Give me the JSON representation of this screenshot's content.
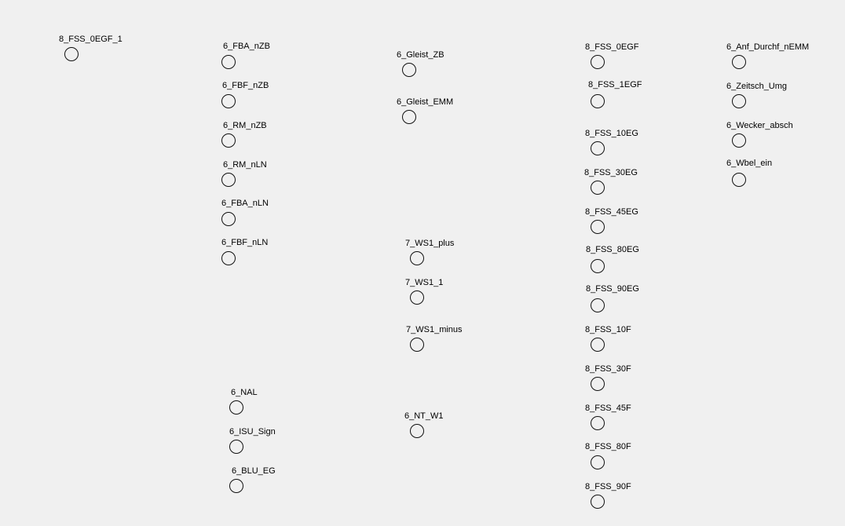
{
  "signals": [
    {
      "id": "s01",
      "label": "8_FSS_0EGF_1"
    },
    {
      "id": "s02",
      "label": "6_FBA_nZB"
    },
    {
      "id": "s03",
      "label": "6_FBF_nZB"
    },
    {
      "id": "s04",
      "label": "6_RM_nZB"
    },
    {
      "id": "s05",
      "label": "6_RM_nLN"
    },
    {
      "id": "s06",
      "label": "6_FBA_nLN"
    },
    {
      "id": "s07",
      "label": "6_FBF_nLN"
    },
    {
      "id": "s08",
      "label": "6_NAL"
    },
    {
      "id": "s09",
      "label": "6_ISU_Sign"
    },
    {
      "id": "s10",
      "label": "6_BLU_EG"
    },
    {
      "id": "s11",
      "label": "6_Gleist_ZB"
    },
    {
      "id": "s12",
      "label": "6_Gleist_EMM"
    },
    {
      "id": "s13",
      "label": "7_WS1_plus"
    },
    {
      "id": "s14",
      "label": "7_WS1_1"
    },
    {
      "id": "s15",
      "label": "7_WS1_minus"
    },
    {
      "id": "s16",
      "label": "6_NT_W1"
    },
    {
      "id": "s17",
      "label": "8_FSS_0EGF"
    },
    {
      "id": "s18",
      "label": "8_FSS_1EGF"
    },
    {
      "id": "s19",
      "label": "8_FSS_10EG"
    },
    {
      "id": "s20",
      "label": "8_FSS_30EG"
    },
    {
      "id": "s21",
      "label": "8_FSS_45EG"
    },
    {
      "id": "s22",
      "label": "8_FSS_80EG"
    },
    {
      "id": "s23",
      "label": "8_FSS_90EG"
    },
    {
      "id": "s24",
      "label": "8_FSS_10F"
    },
    {
      "id": "s25",
      "label": "8_FSS_30F"
    },
    {
      "id": "s26",
      "label": "8_FSS_45F"
    },
    {
      "id": "s27",
      "label": "8_FSS_80F"
    },
    {
      "id": "s28",
      "label": "8_FSS_90F"
    },
    {
      "id": "s29",
      "label": "6_Anf_Durchf_nEMM"
    },
    {
      "id": "s30",
      "label": "6_Zeitsch_Umg"
    },
    {
      "id": "s31",
      "label": "6_Wecker_absch"
    },
    {
      "id": "s32",
      "label": "6_Wbel_ein"
    }
  ]
}
